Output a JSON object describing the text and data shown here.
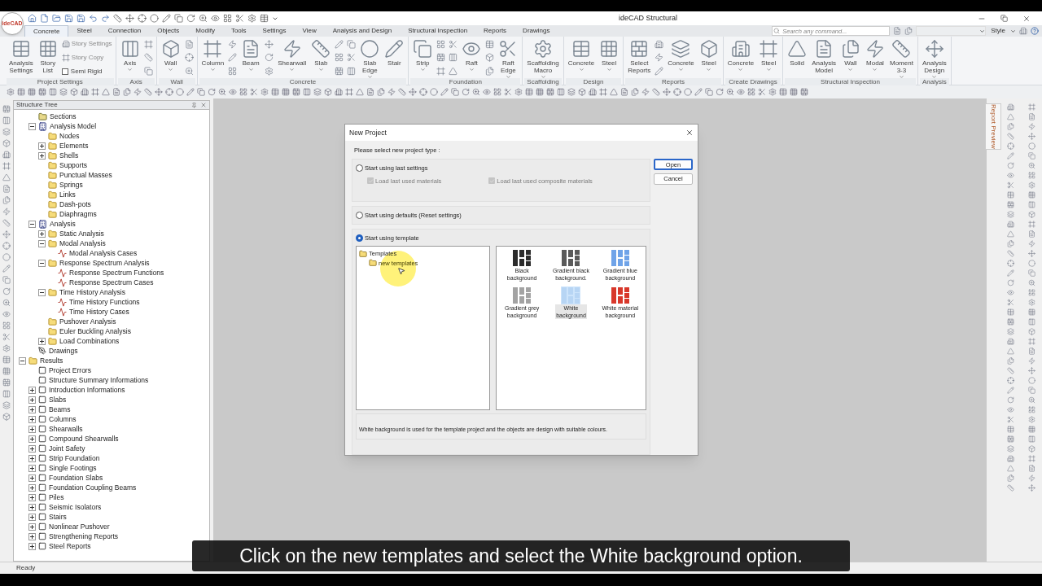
{
  "app": {
    "logo": "ideCAD",
    "title": "ideCAD Structural"
  },
  "tabs": [
    {
      "label": "Concrete",
      "selected": true
    },
    {
      "label": "Steel",
      "selected": false
    },
    {
      "label": "Connection",
      "selected": false
    },
    {
      "label": "Objects",
      "selected": false
    },
    {
      "label": "Modify",
      "selected": false
    },
    {
      "label": "Tools",
      "selected": false
    },
    {
      "label": "Settings",
      "selected": false
    },
    {
      "label": "View",
      "selected": false
    },
    {
      "label": "Analysis and Design",
      "selected": false
    },
    {
      "label": "Structural Inspection",
      "selected": false
    },
    {
      "label": "Reports",
      "selected": false
    },
    {
      "label": "Drawings",
      "selected": false
    }
  ],
  "search": {
    "placeholder": "Search any command..."
  },
  "style_menu": {
    "label": "Style"
  },
  "ribbon": [
    {
      "label": "Project Settings",
      "items": [
        {
          "kind": "large",
          "label": "Analysis\nSettings",
          "dropdown": false
        },
        {
          "kind": "large",
          "label": "Story\nList",
          "dropdown": false
        },
        {
          "kind": "list",
          "entries": [
            {
              "kind": "action",
              "label": "Story Settings"
            },
            {
              "kind": "action",
              "label": "Story Copy"
            },
            {
              "kind": "checkbox",
              "label": "Semi Rigid",
              "checked": false
            }
          ]
        }
      ]
    },
    {
      "label": "Axis",
      "items": [
        {
          "kind": "large",
          "label": "Axis",
          "dropdown": true
        },
        {
          "kind": "icons"
        }
      ]
    },
    {
      "label": "Wall",
      "items": [
        {
          "kind": "large",
          "label": "Wall",
          "dropdown": true
        },
        {
          "kind": "icons"
        }
      ]
    },
    {
      "label": "Concrete",
      "items": [
        {
          "kind": "large",
          "label": "Column",
          "dropdown": true
        },
        {
          "kind": "icons"
        },
        {
          "kind": "large",
          "label": "Beam",
          "dropdown": true
        },
        {
          "kind": "icons"
        },
        {
          "kind": "large",
          "label": "Shearwall",
          "dropdown": true
        },
        {
          "kind": "large",
          "label": "Slab",
          "dropdown": true
        },
        {
          "kind": "icons"
        },
        {
          "kind": "icons"
        },
        {
          "kind": "large",
          "label": "Slab\nEdge",
          "dropdown": true
        },
        {
          "kind": "large",
          "label": "Stair",
          "dropdown": false
        }
      ]
    },
    {
      "label": "Foundation",
      "items": [
        {
          "kind": "large",
          "label": "Strip",
          "dropdown": true
        },
        {
          "kind": "icons"
        },
        {
          "kind": "icons"
        },
        {
          "kind": "large",
          "label": "Raft",
          "dropdown": true
        },
        {
          "kind": "icons"
        },
        {
          "kind": "large",
          "label": "Raft\nEdge",
          "dropdown": true
        }
      ]
    },
    {
      "label": "Scaffolding",
      "items": [
        {
          "kind": "large",
          "label": "Scaffolding\nMacro",
          "dropdown": true
        }
      ]
    },
    {
      "label": "Design",
      "items": [
        {
          "kind": "large",
          "label": "Concrete",
          "dropdown": true
        },
        {
          "kind": "large",
          "label": "Steel",
          "dropdown": true
        }
      ]
    },
    {
      "label": "Reports",
      "items": [
        {
          "kind": "large",
          "label": "Select\nReports",
          "dropdown": false
        },
        {
          "kind": "icons"
        },
        {
          "kind": "large",
          "label": "Concrete",
          "dropdown": true
        },
        {
          "kind": "large",
          "label": "Steel",
          "dropdown": true
        }
      ]
    },
    {
      "label": "Create Drawings",
      "items": [
        {
          "kind": "large",
          "label": "Concrete",
          "dropdown": true
        },
        {
          "kind": "large",
          "label": "Steel",
          "dropdown": true
        }
      ]
    },
    {
      "label": "Structural Inspection",
      "items": [
        {
          "kind": "large",
          "label": "Solid",
          "dropdown": false
        },
        {
          "kind": "large",
          "label": "Analysis\nModel",
          "dropdown": false
        },
        {
          "kind": "large",
          "label": "Wall",
          "dropdown": true
        },
        {
          "kind": "large",
          "label": "Modal",
          "dropdown": true
        },
        {
          "kind": "large",
          "label": "Moment\n3-3",
          "dropdown": true
        }
      ]
    },
    {
      "label": "Analysis",
      "items": [
        {
          "kind": "large",
          "label": "Analysis\nDesign",
          "dropdown": true
        }
      ]
    }
  ],
  "structure_tree": {
    "title": "Structure Tree",
    "items": [
      {
        "children": [
          {
            "label": "Sections",
            "kind": "sections"
          },
          {
            "label": "Analysis Model",
            "kind": "model",
            "expanded": true,
            "children": [
              {
                "label": "Nodes",
                "kind": "folder"
              },
              {
                "label": "Elements",
                "kind": "folder",
                "expanded": false
              },
              {
                "label": "Shells",
                "kind": "folder",
                "expanded": false
              },
              {
                "label": "Supports",
                "kind": "folder"
              },
              {
                "label": "Punctual Masses",
                "kind": "folder"
              },
              {
                "label": "Springs",
                "kind": "folder"
              },
              {
                "label": "Links",
                "kind": "folder"
              },
              {
                "label": "Dash-pots",
                "kind": "folder"
              },
              {
                "label": "Diaphragms",
                "kind": "folder"
              }
            ]
          },
          {
            "label": "Analysis",
            "kind": "model",
            "expanded": true,
            "children": [
              {
                "label": "Static Analysis",
                "kind": "folder",
                "expanded": false
              },
              {
                "label": "Modal Analysis",
                "kind": "folder",
                "expanded": true,
                "children": [
                  {
                    "label": "Modal Analysis Cases",
                    "kind": "chart"
                  }
                ]
              },
              {
                "label": "Response Spectrum Analysis",
                "kind": "folder",
                "expanded": true,
                "children": [
                  {
                    "label": "Response Spectrum Functions",
                    "kind": "chart"
                  },
                  {
                    "label": "Response Spectrum Cases",
                    "kind": "chart"
                  }
                ]
              },
              {
                "label": "Time History Analysis",
                "kind": "folder",
                "expanded": true,
                "children": [
                  {
                    "label": "Time History Functions",
                    "kind": "chart"
                  },
                  {
                    "label": "Time History Cases",
                    "kind": "chart"
                  }
                ]
              },
              {
                "label": "Pushover Analysis",
                "kind": "folder"
              },
              {
                "label": "Euler Buckling Analysis",
                "kind": "folder"
              },
              {
                "label": "Load Combinations",
                "kind": "folder",
                "expanded": false
              }
            ]
          },
          {
            "label": "Drawings",
            "kind": "drawing"
          }
        ]
      },
      {
        "label": "Results",
        "kind": "folder",
        "expanded": true,
        "children": [
          {
            "label": "Project Errors",
            "kind": "page"
          },
          {
            "label": "Structure Summary Informations",
            "kind": "page"
          },
          {
            "label": "Introduction Informations",
            "kind": "page",
            "expanded": false
          },
          {
            "label": "Slabs",
            "kind": "page",
            "expanded": false
          },
          {
            "label": "Beams",
            "kind": "page",
            "expanded": false
          },
          {
            "label": "Columns",
            "kind": "page",
            "expanded": false
          },
          {
            "label": "Shearwalls",
            "kind": "page",
            "expanded": false
          },
          {
            "label": "Compound Shearwalls",
            "kind": "page",
            "expanded": false
          },
          {
            "label": "Joint Safety",
            "kind": "page",
            "expanded": false
          },
          {
            "label": "Strip Foundation",
            "kind": "page",
            "expanded": false
          },
          {
            "label": "Single Footings",
            "kind": "page",
            "expanded": false
          },
          {
            "label": "Foundation Slabs",
            "kind": "page",
            "expanded": false
          },
          {
            "label": "Foundation Coupling Beams",
            "kind": "page",
            "expanded": false
          },
          {
            "label": "Piles",
            "kind": "page",
            "expanded": false
          },
          {
            "label": "Seismic Isolators",
            "kind": "page",
            "expanded": false
          },
          {
            "label": "Stairs",
            "kind": "page",
            "expanded": false
          },
          {
            "label": "Nonlinear Pushover",
            "kind": "page",
            "expanded": false
          },
          {
            "label": "Strengthening Reports",
            "kind": "page",
            "expanded": false
          },
          {
            "label": "Steel Reports",
            "kind": "page",
            "expanded": false
          }
        ]
      }
    ]
  },
  "side_tab": {
    "label": "Report Preview"
  },
  "status_bar": {
    "text": "Ready"
  },
  "dialog": {
    "title": "New Project",
    "prompt": "Please select new project type :",
    "options": [
      {
        "label": "Start using last settings",
        "selected": false,
        "checkboxes": [
          {
            "label": "Load last used materials",
            "checked": true,
            "disabled": true
          },
          {
            "label": "Load last used composite materials",
            "checked": true,
            "disabled": true
          }
        ]
      },
      {
        "label": "Start using defaults (Reset settings)",
        "selected": false
      },
      {
        "label": "Start using template",
        "selected": true,
        "tree": [
          {
            "label": "Templates",
            "children": [
              {
                "label": "new templates"
              }
            ]
          }
        ],
        "templates": [
          {
            "label": "Black\nbackground",
            "color": "#2b2b2b",
            "selected": false
          },
          {
            "label": "Gradient black\nbackground.",
            "color": "#5a5a5a",
            "selected": false
          },
          {
            "label": "Gradient blue\nbackground",
            "color": "#6fa3e8",
            "selected": false
          },
          {
            "label": "Gradient grey\nbackground",
            "color": "#a3a3a3",
            "selected": false
          },
          {
            "label": "White\nbackground",
            "color": "#b7d5f4",
            "selected": true
          },
          {
            "label": "White material\nbackground",
            "color": "#d8382b",
            "selected": false
          }
        ],
        "description": "White background is used for the template project and the objects are design with suitable colours."
      }
    ],
    "buttons": [
      {
        "label": "Open",
        "default": true
      },
      {
        "label": "Cancel",
        "default": false
      }
    ]
  },
  "caption": "Click on the new templates and select the White background option."
}
